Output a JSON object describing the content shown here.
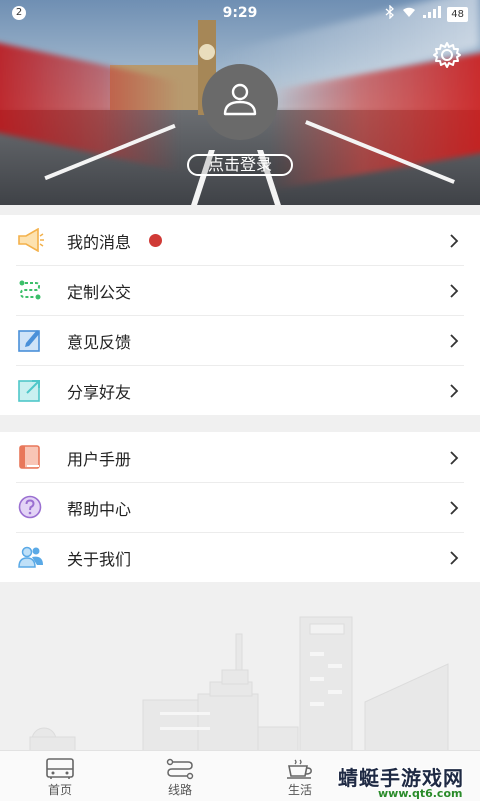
{
  "status_bar": {
    "notification_count": "2",
    "time": "9:29",
    "battery": "48"
  },
  "header": {
    "login_label": "点击登录"
  },
  "menu_groups": [
    {
      "items": [
        {
          "label": "我的消息",
          "icon": "megaphone-icon",
          "icon_color": "#f3b14b",
          "has_dot": true
        },
        {
          "label": "定制公交",
          "icon": "route-icon",
          "icon_color": "#3cbf6a"
        },
        {
          "label": "意见反馈",
          "icon": "feedback-edit-icon",
          "icon_color": "#4a90d9"
        },
        {
          "label": "分享好友",
          "icon": "share-icon",
          "icon_color": "#4fc7c9"
        }
      ]
    },
    {
      "items": [
        {
          "label": "用户手册",
          "icon": "manual-book-icon",
          "icon_color": "#e8775a"
        },
        {
          "label": "帮助中心",
          "icon": "help-question-icon",
          "icon_color": "#9a6fd1"
        },
        {
          "label": "关于我们",
          "icon": "people-icon",
          "icon_color": "#5aa9e6"
        }
      ]
    }
  ],
  "tabs": [
    {
      "label": "首页",
      "icon": "bus-icon"
    },
    {
      "label": "线路",
      "icon": "line-route-icon"
    },
    {
      "label": "生活",
      "icon": "coffee-cup-icon"
    }
  ],
  "watermark": {
    "title": "蜻蜓手游戏网",
    "url": "www.qt6.com"
  },
  "colors": {
    "accent_red": "#d03a36",
    "background": "#f0f0f0"
  }
}
